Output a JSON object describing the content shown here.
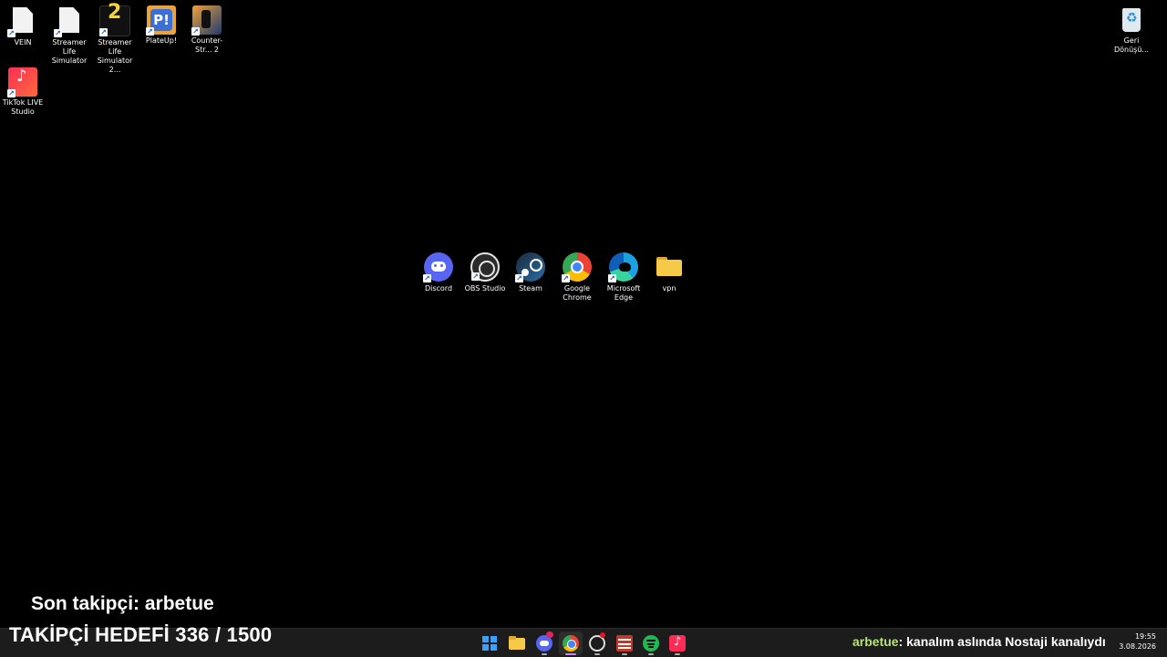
{
  "desktop": {
    "icons": [
      {
        "label": "VEIN",
        "icon": "file-icon"
      },
      {
        "label": "Streamer Life Simulator",
        "icon": "file-icon"
      },
      {
        "label": "Streamer Life Simulator 2...",
        "icon": "game-icon"
      },
      {
        "label": "PlateUp!",
        "icon": "game-icon"
      },
      {
        "label": "Counter-Str... 2",
        "icon": "game-icon"
      },
      {
        "label": "TikTok LIVE Studio",
        "icon": "tiktok-icon"
      }
    ],
    "recycle_bin": {
      "label": "Geri Dönüşü...",
      "icon": "recycle-bin-icon"
    }
  },
  "center_icons": [
    {
      "label": "Discord",
      "icon": "discord-icon",
      "color": "#5865f2"
    },
    {
      "label": "OBS Studio",
      "icon": "obs-icon",
      "color": "#2b2b2b"
    },
    {
      "label": "Steam",
      "icon": "steam-icon",
      "color": "#1b2838"
    },
    {
      "label": "Google Chrome",
      "icon": "chrome-icon",
      "color": "#4285f4"
    },
    {
      "label": "Microsoft Edge",
      "icon": "edge-icon",
      "color": "#0f7bd8"
    },
    {
      "label": "vpn",
      "icon": "folder-icon",
      "color": "#f7c948"
    }
  ],
  "overlay": {
    "last_follower_label": "Son takipçi: arbetue",
    "follower_goal": "TAKİPÇİ HEDEFİ 336 / 1500",
    "follower_goal_current": 336,
    "follower_goal_target": 1500
  },
  "chat": {
    "user": "arbetue",
    "message": ": kanalım aslında Nostaji kanalıydı"
  },
  "taskbar": {
    "apps": [
      {
        "name": "start-icon",
        "color": "#3aa0ff"
      },
      {
        "name": "file-explorer-icon",
        "color": "#f7c948"
      },
      {
        "name": "discord-icon",
        "color": "#5865f2"
      },
      {
        "name": "chrome-icon",
        "color": "#4285f4"
      },
      {
        "name": "obs-icon",
        "color": "#555555"
      },
      {
        "name": "voicemeeter-icon",
        "color": "#c0392b"
      },
      {
        "name": "spotify-icon",
        "color": "#1db954"
      },
      {
        "name": "tiktok-studio-icon",
        "color": "#fe2c55"
      }
    ],
    "clock_time": "19:55",
    "clock_date": "3.08.2026"
  }
}
